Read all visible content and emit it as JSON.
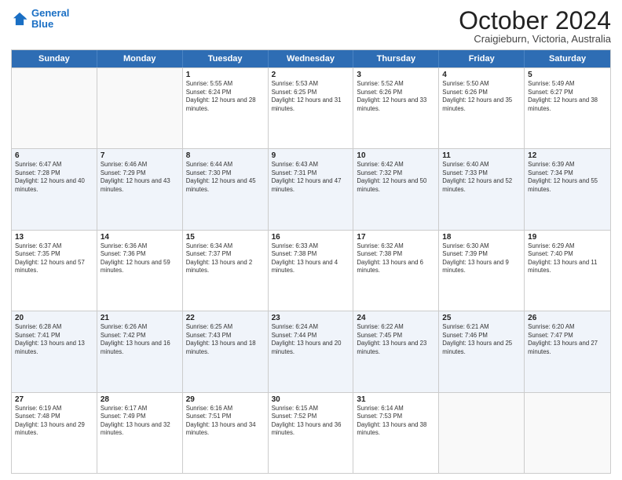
{
  "logo": {
    "line1": "General",
    "line2": "Blue"
  },
  "title": "October 2024",
  "location": "Craigieburn, Victoria, Australia",
  "weekdays": [
    "Sunday",
    "Monday",
    "Tuesday",
    "Wednesday",
    "Thursday",
    "Friday",
    "Saturday"
  ],
  "rows": [
    [
      {
        "day": "",
        "sunrise": "",
        "sunset": "",
        "daylight": "",
        "empty": true
      },
      {
        "day": "",
        "sunrise": "",
        "sunset": "",
        "daylight": "",
        "empty": true
      },
      {
        "day": "1",
        "sunrise": "Sunrise: 5:55 AM",
        "sunset": "Sunset: 6:24 PM",
        "daylight": "Daylight: 12 hours and 28 minutes.",
        "empty": false
      },
      {
        "day": "2",
        "sunrise": "Sunrise: 5:53 AM",
        "sunset": "Sunset: 6:25 PM",
        "daylight": "Daylight: 12 hours and 31 minutes.",
        "empty": false
      },
      {
        "day": "3",
        "sunrise": "Sunrise: 5:52 AM",
        "sunset": "Sunset: 6:26 PM",
        "daylight": "Daylight: 12 hours and 33 minutes.",
        "empty": false
      },
      {
        "day": "4",
        "sunrise": "Sunrise: 5:50 AM",
        "sunset": "Sunset: 6:26 PM",
        "daylight": "Daylight: 12 hours and 35 minutes.",
        "empty": false
      },
      {
        "day": "5",
        "sunrise": "Sunrise: 5:49 AM",
        "sunset": "Sunset: 6:27 PM",
        "daylight": "Daylight: 12 hours and 38 minutes.",
        "empty": false
      }
    ],
    [
      {
        "day": "6",
        "sunrise": "Sunrise: 6:47 AM",
        "sunset": "Sunset: 7:28 PM",
        "daylight": "Daylight: 12 hours and 40 minutes.",
        "empty": false
      },
      {
        "day": "7",
        "sunrise": "Sunrise: 6:46 AM",
        "sunset": "Sunset: 7:29 PM",
        "daylight": "Daylight: 12 hours and 43 minutes.",
        "empty": false
      },
      {
        "day": "8",
        "sunrise": "Sunrise: 6:44 AM",
        "sunset": "Sunset: 7:30 PM",
        "daylight": "Daylight: 12 hours and 45 minutes.",
        "empty": false
      },
      {
        "day": "9",
        "sunrise": "Sunrise: 6:43 AM",
        "sunset": "Sunset: 7:31 PM",
        "daylight": "Daylight: 12 hours and 47 minutes.",
        "empty": false
      },
      {
        "day": "10",
        "sunrise": "Sunrise: 6:42 AM",
        "sunset": "Sunset: 7:32 PM",
        "daylight": "Daylight: 12 hours and 50 minutes.",
        "empty": false
      },
      {
        "day": "11",
        "sunrise": "Sunrise: 6:40 AM",
        "sunset": "Sunset: 7:33 PM",
        "daylight": "Daylight: 12 hours and 52 minutes.",
        "empty": false
      },
      {
        "day": "12",
        "sunrise": "Sunrise: 6:39 AM",
        "sunset": "Sunset: 7:34 PM",
        "daylight": "Daylight: 12 hours and 55 minutes.",
        "empty": false
      }
    ],
    [
      {
        "day": "13",
        "sunrise": "Sunrise: 6:37 AM",
        "sunset": "Sunset: 7:35 PM",
        "daylight": "Daylight: 12 hours and 57 minutes.",
        "empty": false
      },
      {
        "day": "14",
        "sunrise": "Sunrise: 6:36 AM",
        "sunset": "Sunset: 7:36 PM",
        "daylight": "Daylight: 12 hours and 59 minutes.",
        "empty": false
      },
      {
        "day": "15",
        "sunrise": "Sunrise: 6:34 AM",
        "sunset": "Sunset: 7:37 PM",
        "daylight": "Daylight: 13 hours and 2 minutes.",
        "empty": false
      },
      {
        "day": "16",
        "sunrise": "Sunrise: 6:33 AM",
        "sunset": "Sunset: 7:38 PM",
        "daylight": "Daylight: 13 hours and 4 minutes.",
        "empty": false
      },
      {
        "day": "17",
        "sunrise": "Sunrise: 6:32 AM",
        "sunset": "Sunset: 7:38 PM",
        "daylight": "Daylight: 13 hours and 6 minutes.",
        "empty": false
      },
      {
        "day": "18",
        "sunrise": "Sunrise: 6:30 AM",
        "sunset": "Sunset: 7:39 PM",
        "daylight": "Daylight: 13 hours and 9 minutes.",
        "empty": false
      },
      {
        "day": "19",
        "sunrise": "Sunrise: 6:29 AM",
        "sunset": "Sunset: 7:40 PM",
        "daylight": "Daylight: 13 hours and 11 minutes.",
        "empty": false
      }
    ],
    [
      {
        "day": "20",
        "sunrise": "Sunrise: 6:28 AM",
        "sunset": "Sunset: 7:41 PM",
        "daylight": "Daylight: 13 hours and 13 minutes.",
        "empty": false
      },
      {
        "day": "21",
        "sunrise": "Sunrise: 6:26 AM",
        "sunset": "Sunset: 7:42 PM",
        "daylight": "Daylight: 13 hours and 16 minutes.",
        "empty": false
      },
      {
        "day": "22",
        "sunrise": "Sunrise: 6:25 AM",
        "sunset": "Sunset: 7:43 PM",
        "daylight": "Daylight: 13 hours and 18 minutes.",
        "empty": false
      },
      {
        "day": "23",
        "sunrise": "Sunrise: 6:24 AM",
        "sunset": "Sunset: 7:44 PM",
        "daylight": "Daylight: 13 hours and 20 minutes.",
        "empty": false
      },
      {
        "day": "24",
        "sunrise": "Sunrise: 6:22 AM",
        "sunset": "Sunset: 7:45 PM",
        "daylight": "Daylight: 13 hours and 23 minutes.",
        "empty": false
      },
      {
        "day": "25",
        "sunrise": "Sunrise: 6:21 AM",
        "sunset": "Sunset: 7:46 PM",
        "daylight": "Daylight: 13 hours and 25 minutes.",
        "empty": false
      },
      {
        "day": "26",
        "sunrise": "Sunrise: 6:20 AM",
        "sunset": "Sunset: 7:47 PM",
        "daylight": "Daylight: 13 hours and 27 minutes.",
        "empty": false
      }
    ],
    [
      {
        "day": "27",
        "sunrise": "Sunrise: 6:19 AM",
        "sunset": "Sunset: 7:48 PM",
        "daylight": "Daylight: 13 hours and 29 minutes.",
        "empty": false
      },
      {
        "day": "28",
        "sunrise": "Sunrise: 6:17 AM",
        "sunset": "Sunset: 7:49 PM",
        "daylight": "Daylight: 13 hours and 32 minutes.",
        "empty": false
      },
      {
        "day": "29",
        "sunrise": "Sunrise: 6:16 AM",
        "sunset": "Sunset: 7:51 PM",
        "daylight": "Daylight: 13 hours and 34 minutes.",
        "empty": false
      },
      {
        "day": "30",
        "sunrise": "Sunrise: 6:15 AM",
        "sunset": "Sunset: 7:52 PM",
        "daylight": "Daylight: 13 hours and 36 minutes.",
        "empty": false
      },
      {
        "day": "31",
        "sunrise": "Sunrise: 6:14 AM",
        "sunset": "Sunset: 7:53 PM",
        "daylight": "Daylight: 13 hours and 38 minutes.",
        "empty": false
      },
      {
        "day": "",
        "sunrise": "",
        "sunset": "",
        "daylight": "",
        "empty": true
      },
      {
        "day": "",
        "sunrise": "",
        "sunset": "",
        "daylight": "",
        "empty": true
      }
    ]
  ],
  "alt_rows": [
    1,
    3
  ]
}
